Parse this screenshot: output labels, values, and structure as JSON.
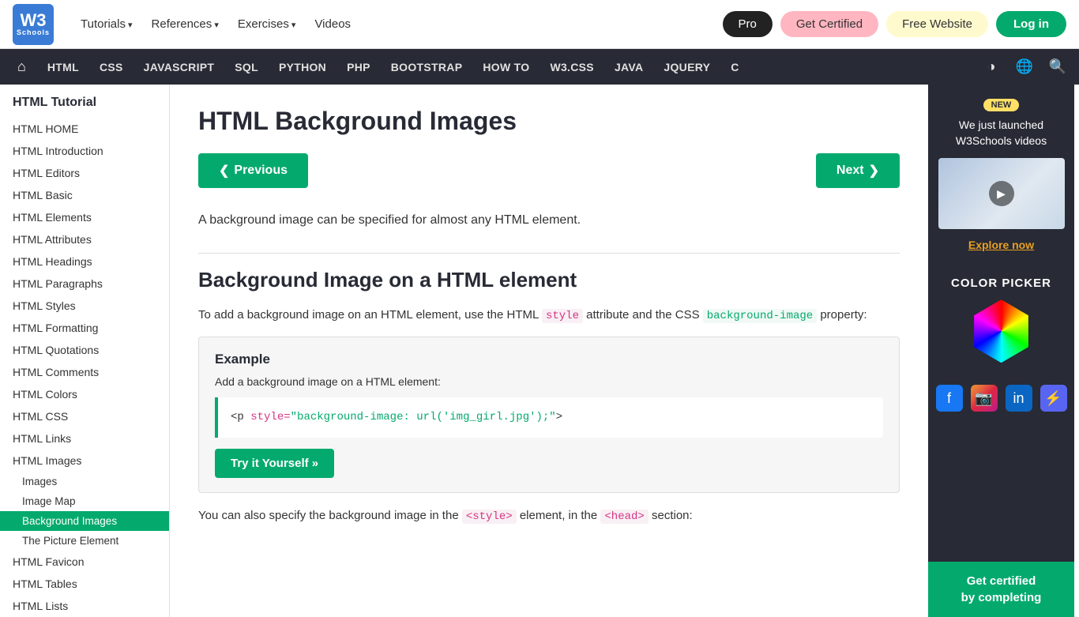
{
  "topnav": {
    "logo_w3": "W3",
    "logo_schools": "Schools",
    "links": [
      {
        "label": "Tutorials",
        "has_arrow": true
      },
      {
        "label": "References",
        "has_arrow": true
      },
      {
        "label": "Exercises",
        "has_arrow": true
      },
      {
        "label": "Videos",
        "has_arrow": false
      }
    ],
    "btn_pro": "Pro",
    "btn_certified": "Get Certified",
    "btn_free_website": "Free Website",
    "btn_login": "Log in"
  },
  "mainnav": {
    "items": [
      {
        "label": "HTML"
      },
      {
        "label": "CSS"
      },
      {
        "label": "JAVASCRIPT"
      },
      {
        "label": "SQL"
      },
      {
        "label": "PYTHON"
      },
      {
        "label": "PHP"
      },
      {
        "label": "BOOTSTRAP"
      },
      {
        "label": "HOW TO"
      },
      {
        "label": "W3.CSS"
      },
      {
        "label": "JAVA"
      },
      {
        "label": "JQUERY"
      },
      {
        "label": "C"
      }
    ]
  },
  "sidebar": {
    "title": "HTML Tutorial",
    "items": [
      {
        "label": "HTML HOME",
        "sub": false,
        "active": false
      },
      {
        "label": "HTML Introduction",
        "sub": false,
        "active": false
      },
      {
        "label": "HTML Editors",
        "sub": false,
        "active": false
      },
      {
        "label": "HTML Basic",
        "sub": false,
        "active": false
      },
      {
        "label": "HTML Elements",
        "sub": false,
        "active": false
      },
      {
        "label": "HTML Attributes",
        "sub": false,
        "active": false
      },
      {
        "label": "HTML Headings",
        "sub": false,
        "active": false
      },
      {
        "label": "HTML Paragraphs",
        "sub": false,
        "active": false
      },
      {
        "label": "HTML Styles",
        "sub": false,
        "active": false
      },
      {
        "label": "HTML Formatting",
        "sub": false,
        "active": false
      },
      {
        "label": "HTML Quotations",
        "sub": false,
        "active": false
      },
      {
        "label": "HTML Comments",
        "sub": false,
        "active": false
      },
      {
        "label": "HTML Colors",
        "sub": false,
        "active": false
      },
      {
        "label": "HTML CSS",
        "sub": false,
        "active": false
      },
      {
        "label": "HTML Links",
        "sub": false,
        "active": false
      },
      {
        "label": "HTML Images",
        "sub": false,
        "active": false
      },
      {
        "label": "Images",
        "sub": true,
        "active": false
      },
      {
        "label": "Image Map",
        "sub": true,
        "active": false
      },
      {
        "label": "Background Images",
        "sub": true,
        "active": true
      },
      {
        "label": "The Picture Element",
        "sub": true,
        "active": false
      },
      {
        "label": "HTML Favicon",
        "sub": false,
        "active": false
      },
      {
        "label": "HTML Tables",
        "sub": false,
        "active": false
      },
      {
        "label": "HTML Lists",
        "sub": false,
        "active": false
      }
    ]
  },
  "content": {
    "page_title": "HTML Background Images",
    "btn_prev": "❮ Previous",
    "btn_next": "Next ❯",
    "intro": "A background image can be specified for almost any HTML element.",
    "section_title": "Background Image on a HTML element",
    "section_text_1": "To add a background image on an HTML element, use the HTML ",
    "code_style": "style",
    "section_text_2": " attribute and the CSS ",
    "code_bg_image": "background-image",
    "section_text_3": " property:",
    "example_label": "Example",
    "example_sub": "Add a background image on a HTML element:",
    "code_line": "<p style=\"background-image: url('img_girl.jpg');\">",
    "btn_try": "Try it Yourself »",
    "bottom_text": "You can also specify the background image in the ",
    "code_style_tag": "<style>",
    "bottom_text_2": " element, in the ",
    "code_head_tag": "<head>",
    "bottom_text_3": " section:"
  },
  "right_sidebar": {
    "badge": "NEW",
    "promo_text": "We just launched W3Schools videos",
    "explore_link": "Explore now",
    "color_picker_title": "COLOR PICKER",
    "social": [
      "f",
      "ig",
      "in",
      "dc"
    ],
    "get_certified": "Get certified\nby completing"
  }
}
